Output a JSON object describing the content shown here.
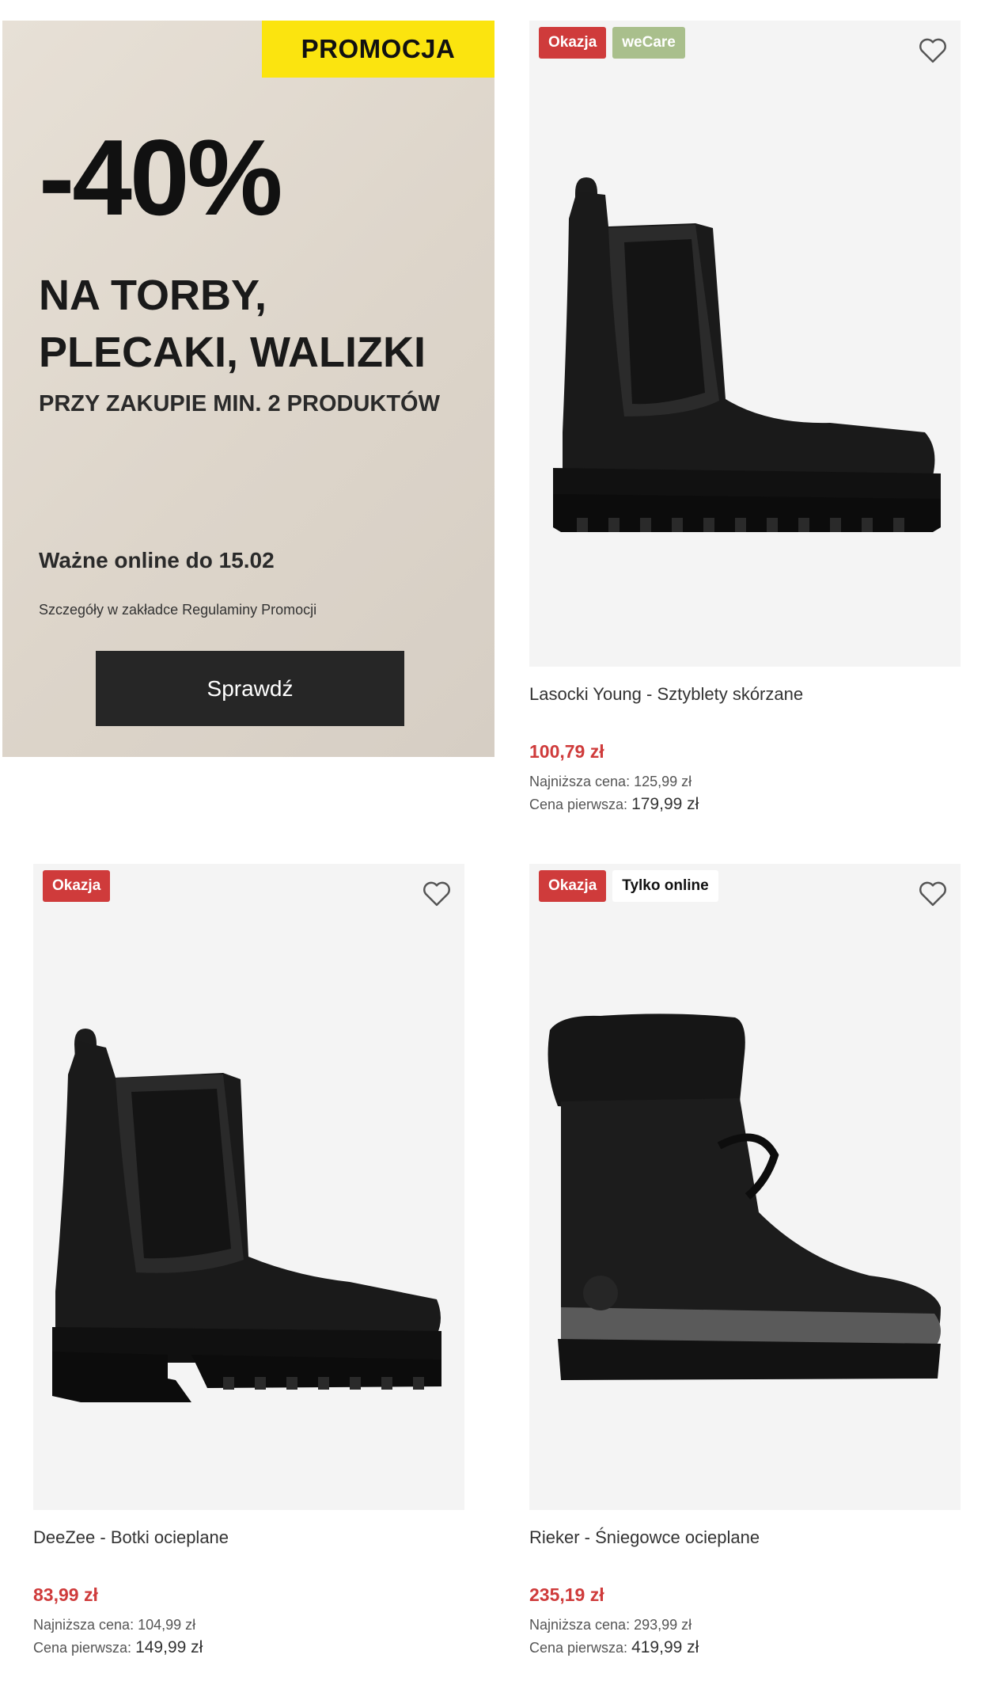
{
  "promo": {
    "tag": "PROMOCJA",
    "discount": "-40%",
    "line1": "NA TORBY,",
    "line2": "PLECAKI, WALIZKI",
    "line3": "PRZY ZAKUPIE MIN. 2 PRODUKTÓW",
    "valid": "Ważne online do 15.02",
    "details": "Szczegóły w zakładce Regulaminy Promocji",
    "button": "Sprawdź",
    "accent_color": "#fbe40f"
  },
  "products": [
    {
      "badges": [
        "Okazja",
        "weCare"
      ],
      "name": "Lasocki Young - Sztyblety skórzane",
      "price": "100,79 zł",
      "lowest_label": "Najniższa cena:",
      "lowest_value": "125,99 zł",
      "first_label": "Cena pierwsza:",
      "first_value": "179,99 zł"
    },
    {
      "badges": [
        "Okazja"
      ],
      "name": "DeeZee - Botki ocieplane",
      "price": "83,99 zł",
      "lowest_label": "Najniższa cena:",
      "lowest_value": "104,99 zł",
      "first_label": "Cena pierwsza:",
      "first_value": "149,99 zł"
    },
    {
      "badges": [
        "Okazja",
        "Tylko online"
      ],
      "name": "Rieker - Śniegowce ocieplane",
      "price": "235,19 zł",
      "lowest_label": "Najniższa cena:",
      "lowest_value": "293,99 zł",
      "first_label": "Cena pierwsza:",
      "first_value": "419,99 zł"
    }
  ],
  "icons": {
    "favorite": "heart-outline-icon"
  },
  "colors": {
    "sale": "#cf3b3b",
    "wecare": "#a9bf8c",
    "button": "#262626"
  }
}
